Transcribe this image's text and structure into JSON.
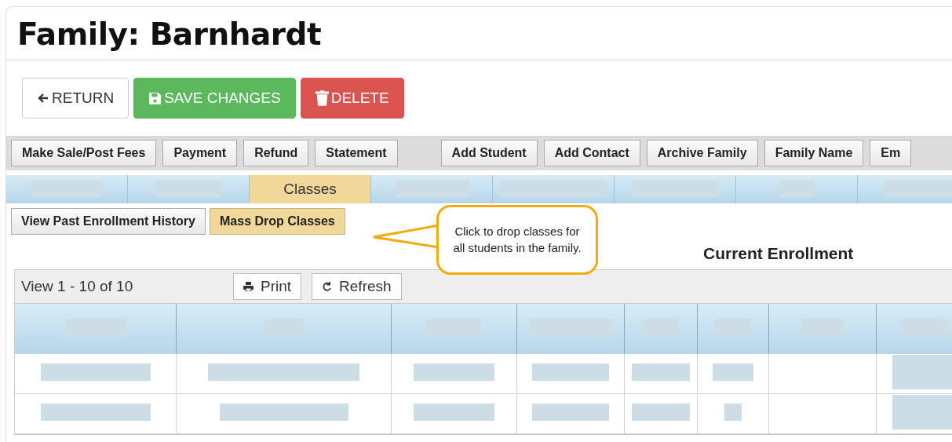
{
  "title": "Family: Barnhardt",
  "actions": [
    {
      "label": "RETURN",
      "kind": "return"
    },
    {
      "label": "SAVE CHANGES",
      "kind": "save"
    },
    {
      "label": "DELETE",
      "kind": "delete"
    }
  ],
  "toolbar": {
    "left": [
      "Make Sale/Post Fees",
      "Payment",
      "Refund",
      "Statement"
    ],
    "right": [
      "Add Student",
      "Add Contact",
      "Archive Family",
      "Family Name",
      "Em"
    ]
  },
  "tabs": [
    {
      "kind": "redacted",
      "selected": false
    },
    {
      "kind": "redacted",
      "selected": false
    },
    {
      "kind": "label",
      "label": "Classes",
      "selected": true
    },
    {
      "kind": "redacted",
      "selected": false
    },
    {
      "kind": "redacted",
      "selected": false
    },
    {
      "kind": "redacted",
      "selected": false
    },
    {
      "kind": "redacted",
      "selected": false
    },
    {
      "kind": "redacted",
      "selected": false
    }
  ],
  "sub_actions": [
    {
      "label": "View Past Enrollment History",
      "highlighted": false
    },
    {
      "label": "Mass Drop Classes",
      "highlighted": true
    }
  ],
  "callout": "Click to drop classes for all students in the family.",
  "enrollment": {
    "heading": "Current Enrollment",
    "pager": "View 1 - 10 of 10",
    "grid_buttons": [
      {
        "label": "Print",
        "kind": "print"
      },
      {
        "label": "Refresh",
        "kind": "refresh"
      }
    ],
    "columns": [
      {
        "kind": "redacted"
      },
      {
        "kind": "redacted"
      },
      {
        "kind": "redacted"
      },
      {
        "kind": "redacted"
      },
      {
        "kind": "redacted"
      },
      {
        "kind": "redacted"
      },
      {
        "kind": "redacted"
      },
      {
        "kind": "redacted"
      }
    ],
    "rows": [
      {
        "cells": [
          {
            "kind": "redacted"
          },
          {
            "kind": "redacted"
          },
          {
            "kind": "redacted"
          },
          {
            "kind": "redacted"
          },
          {
            "kind": "redacted"
          },
          {
            "kind": "redacted"
          },
          {
            "kind": "empty"
          },
          {
            "kind": "redacted"
          }
        ]
      },
      {
        "cells": [
          {
            "kind": "redacted"
          },
          {
            "kind": "redacted"
          },
          {
            "kind": "redacted"
          },
          {
            "kind": "redacted"
          },
          {
            "kind": "redacted"
          },
          {
            "kind": "redacted"
          },
          {
            "kind": "empty"
          },
          {
            "kind": "redacted"
          }
        ]
      }
    ]
  }
}
